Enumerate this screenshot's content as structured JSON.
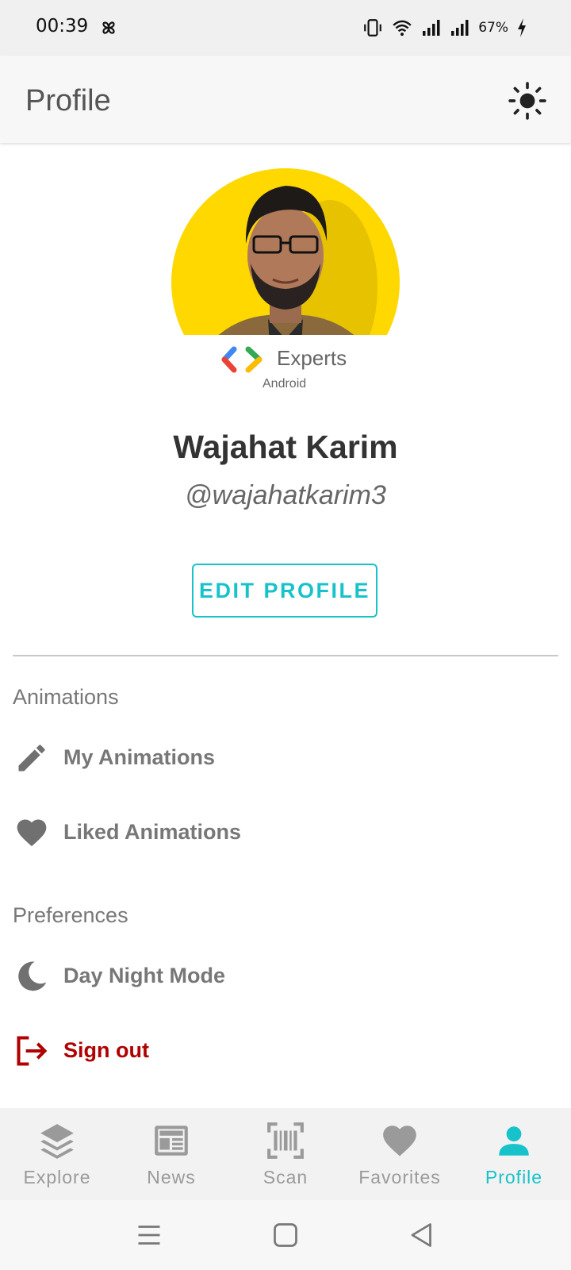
{
  "status_bar": {
    "time": "00:39",
    "battery": "67%"
  },
  "app_bar": {
    "title": "Profile",
    "theme_icon": "sun-icon"
  },
  "profile": {
    "avatar_icon": "avatar-photo",
    "badge_experts": "Experts",
    "badge_android": "Android",
    "name": "Wajahat Karim",
    "handle": "@wajahatkarim3",
    "edit_button": "EDIT PROFILE"
  },
  "sections": {
    "animations": {
      "header": "Animations",
      "items": [
        {
          "label": "My Animations",
          "icon": "pencil-icon"
        },
        {
          "label": "Liked Animations",
          "icon": "heart-icon"
        }
      ]
    },
    "preferences": {
      "header": "Preferences",
      "items": [
        {
          "label": "Day Night Mode",
          "icon": "moon-icon"
        },
        {
          "label": "Sign out",
          "icon": "sign-out-icon"
        }
      ]
    }
  },
  "bottom_nav": {
    "items": [
      {
        "label": "Explore",
        "icon": "layers-icon"
      },
      {
        "label": "News",
        "icon": "newspaper-icon"
      },
      {
        "label": "Scan",
        "icon": "barcode-scan-icon"
      },
      {
        "label": "Favorites",
        "icon": "heart-icon"
      },
      {
        "label": "Profile",
        "icon": "person-icon"
      }
    ],
    "active": "Profile"
  },
  "colors": {
    "accent": "#18c2cb",
    "danger": "#b00000",
    "avatar_bg": "#ffd800",
    "text_muted": "#777777"
  }
}
